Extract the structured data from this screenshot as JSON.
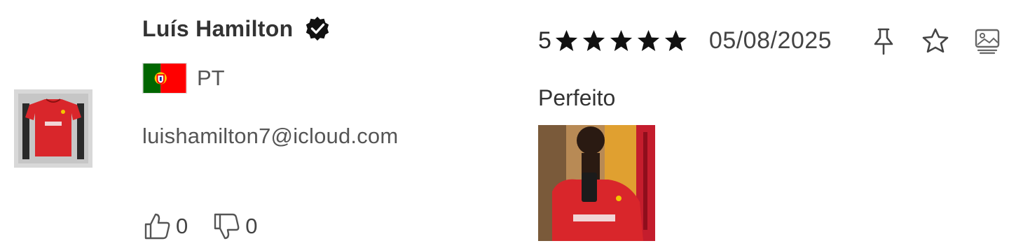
{
  "reviewer": {
    "name": "Luís Hamilton",
    "verified_icon": "verified-check-icon",
    "country_code": "PT",
    "country_flag": "portugal-flag",
    "email": "luishamilton7@icloud.com"
  },
  "votes": {
    "likes": "0",
    "dislikes": "0"
  },
  "review": {
    "rating": "5",
    "stars": 5,
    "date": "05/08/2025",
    "text": "Perfeito",
    "photo": "customer-photo-red-jersey"
  },
  "product": {
    "thumbnail": "red-football-jersey"
  },
  "actions": [
    "pin-icon",
    "star-outline-icon",
    "image-gallery-icon"
  ],
  "colors": {
    "jersey_red": "#d9262b",
    "text": "#2b2b2b",
    "muted": "#555555"
  }
}
